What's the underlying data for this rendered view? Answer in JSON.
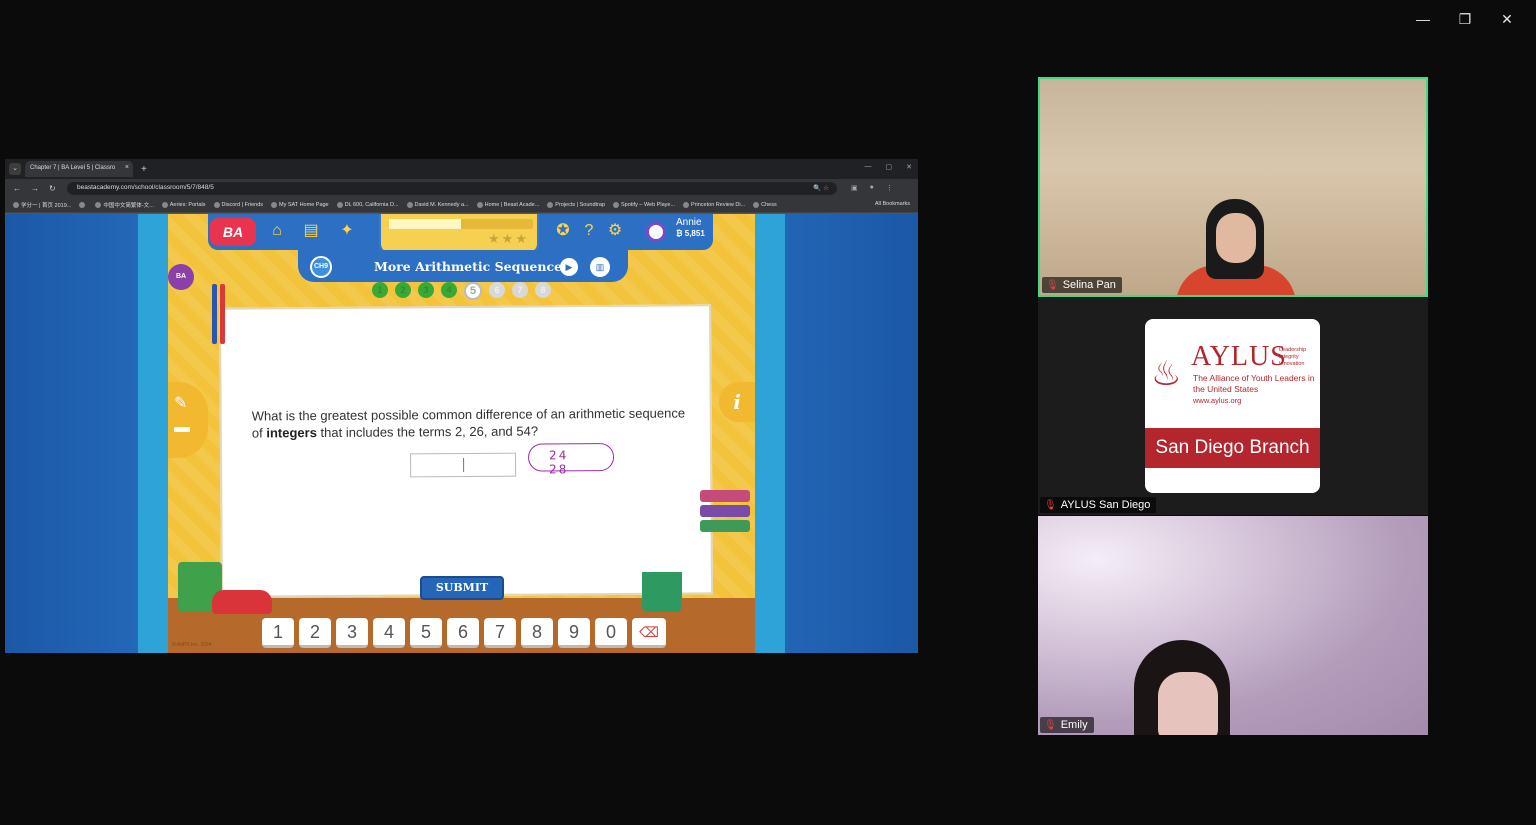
{
  "window_controls": {
    "minimize": "—",
    "restore": "❐",
    "close": "✕"
  },
  "browser": {
    "tab_title": "Chapter 7 | BA Level 5 | Classro",
    "tab_close": "×",
    "new_tab": "+",
    "url": "beastacademy.com/school/classroom/5/7/848/5",
    "bookmarks": [
      "学分一 | 首页 2019...",
      "",
      "中国中文简繁体-文...",
      "Aeries: Portals",
      "Discord | Friends",
      "My SAT Home Page",
      "DL 600, California D...",
      "David M. Kennedy a...",
      "Home | Beast Acade...",
      "Projects | Soundtrap",
      "Spotify – Web Playe...",
      "Princeton Review Di...",
      "Chess"
    ],
    "all_bookmarks": "All Bookmarks"
  },
  "game": {
    "logo": "BA",
    "user_name": "Annie",
    "coins": "₿ 5,851",
    "chapter_badge": "CH9",
    "lesson_title": "More Arithmetic Sequences",
    "steps": [
      "1",
      "2",
      "3",
      "4",
      "5",
      "6",
      "7",
      "8"
    ],
    "current_step": 5,
    "progress": 0.5,
    "stars": "★★★",
    "question_part1": "What is the greatest possible common difference of an arithmetic sequence of ",
    "question_bold": "integers",
    "question_part2": " that includes the terms 2, 26, and 54?",
    "handwriting": "24 28",
    "submit": "SUBMIT",
    "keypad": [
      "1",
      "2",
      "3",
      "4",
      "5",
      "6",
      "7",
      "8",
      "9",
      "0"
    ],
    "info": "i",
    "copyright": "© AoPS Inc. 2024"
  },
  "participants": [
    {
      "name": "Selina Pan",
      "muted": true,
      "active_speaker": true
    },
    {
      "name": "AYLUS San Diego",
      "muted": true,
      "active_speaker": false
    },
    {
      "name": "Emily",
      "muted": true,
      "active_speaker": false
    }
  ],
  "aylus_card": {
    "title": "AYLUS",
    "motto_1": "Leadership",
    "motto_2": "Integrity",
    "motto_3": "Innovation",
    "subtitle": "The Alliance of Youth Leaders in the United States",
    "url": "www.aylus.org",
    "branch": "San Diego Branch"
  },
  "colors": {
    "active_speaker_border": "#3ddc84",
    "aylus_red": "#b3262d",
    "game_yellow": "#f3c33c",
    "ba_blue": "#2d6fc3"
  }
}
